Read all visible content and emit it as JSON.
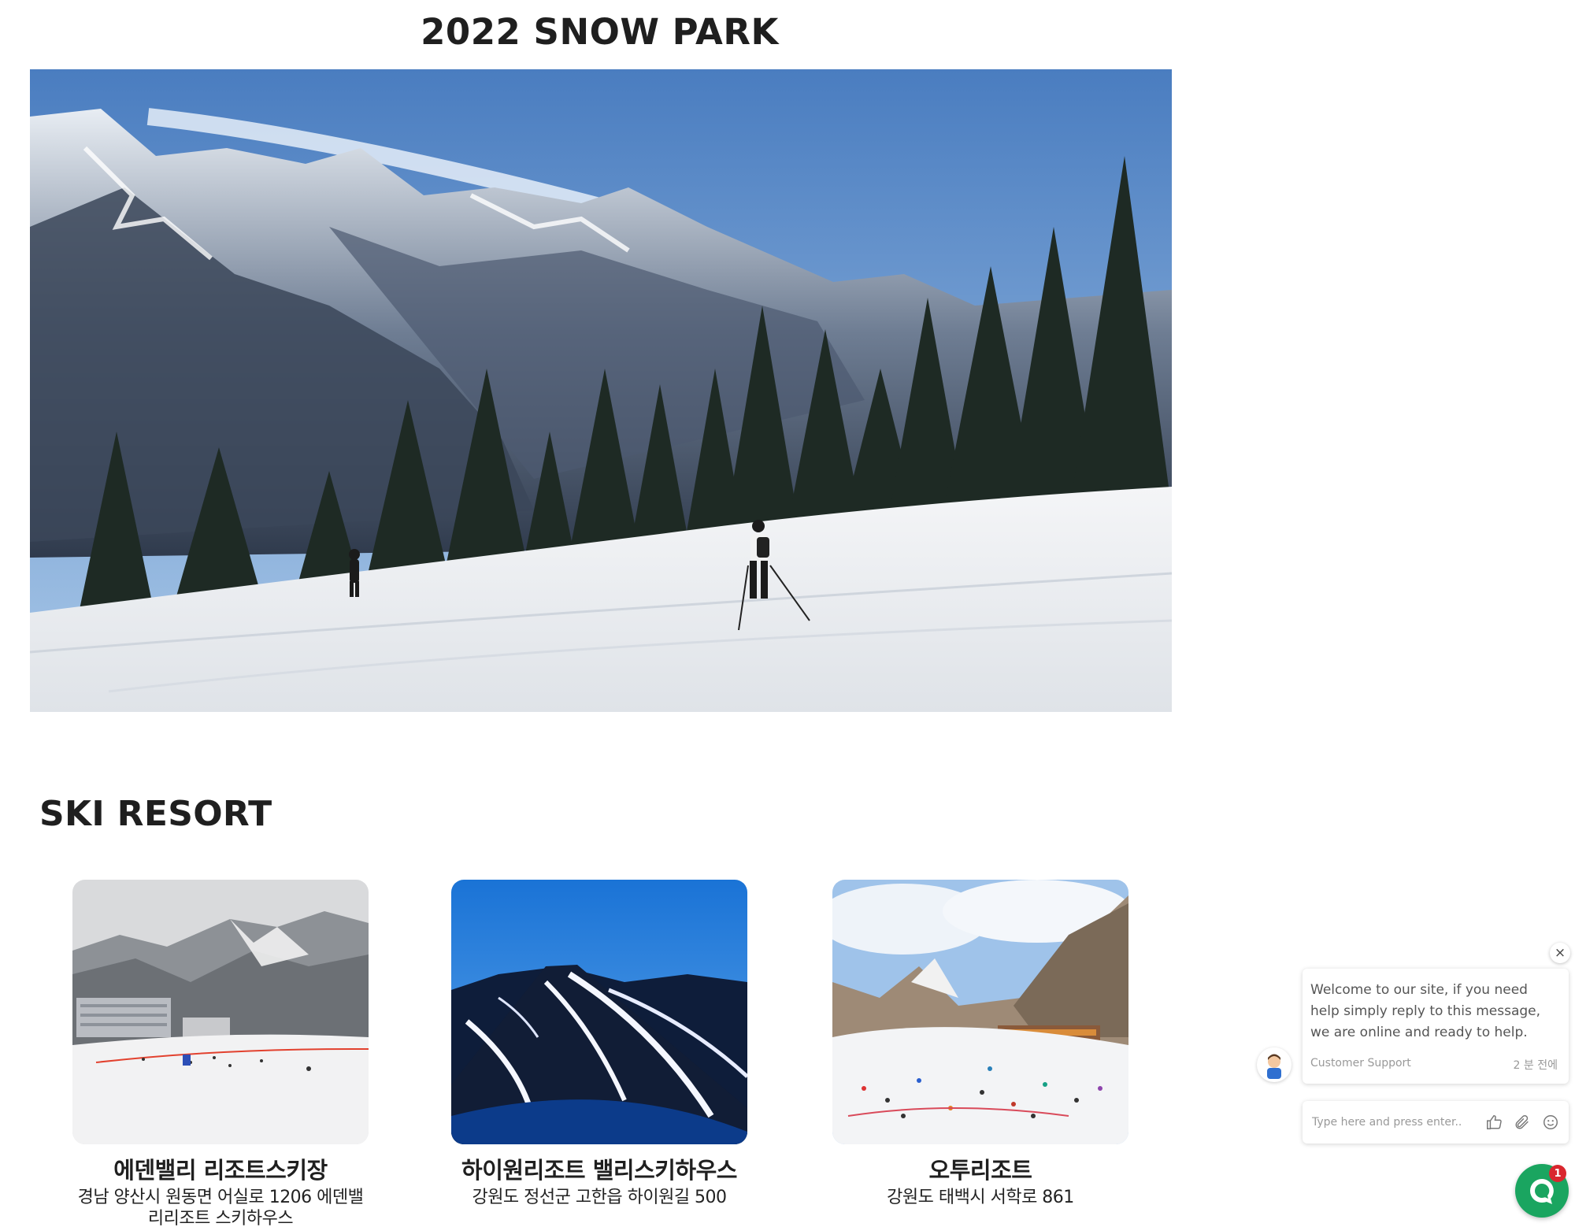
{
  "hero": {
    "title": "2022 SNOW PARK",
    "image_icon": "mountain-ski-photo"
  },
  "resorts": {
    "section_title": "SKI RESORT",
    "cards": [
      {
        "name": "에덴밸리 리조트스키장",
        "address": "경남 양산시 원동면 어실로 1206 에덴밸리리조트 스키하우스",
        "image_icon": "resort-day-photo"
      },
      {
        "name": "하이원리조트 밸리스키하우스",
        "address": "강원도 정선군 고한읍 하이원길 500",
        "image_icon": "resort-night-photo"
      },
      {
        "name": "오투리조트",
        "address": "강원도 태백시 서학로 861",
        "image_icon": "resort-slope-photo"
      }
    ]
  },
  "chat": {
    "close_glyph": "×",
    "message": "Welcome to our site, if you need help simply reply to this message, we are online and ready to help.",
    "agent_name": "Customer Support",
    "time_ago": "2 분 전에",
    "input_placeholder": "Type here and press enter..",
    "badge_count": "1",
    "colors": {
      "launcher": "#1aa560",
      "badge": "#d9272e"
    }
  }
}
